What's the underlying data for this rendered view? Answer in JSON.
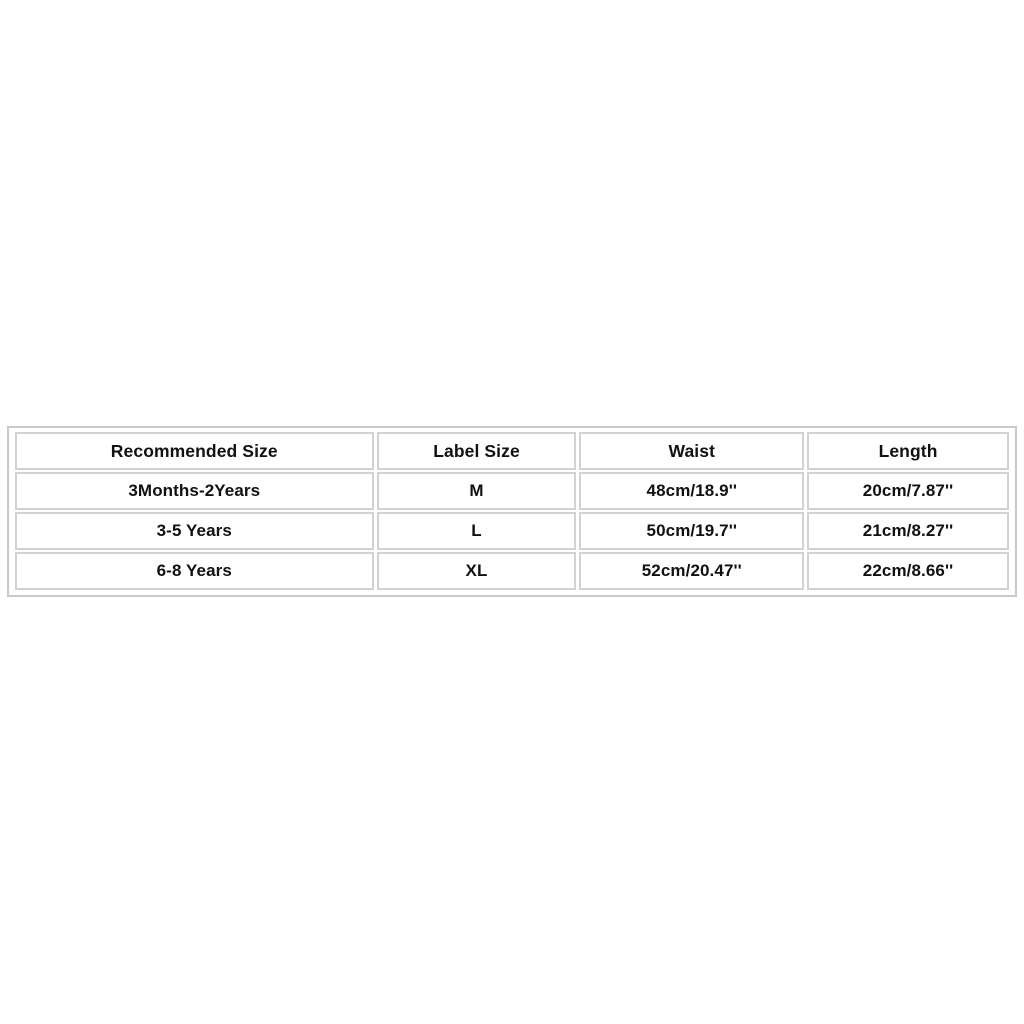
{
  "page": {
    "background_color": "#ffffff",
    "content_type": "size-chart-table"
  },
  "size_chart": {
    "border_color": "#c8c8c8",
    "cell_border_color": "#d2d2d2",
    "text_color": "#111111",
    "columns": [
      {
        "key": "recommended_size",
        "header": "Recommended Size"
      },
      {
        "key": "label_size",
        "header": "Label Size"
      },
      {
        "key": "waist",
        "header": "Waist"
      },
      {
        "key": "length",
        "header": "Length"
      }
    ],
    "rows": [
      {
        "recommended_size": "3Months-2Years",
        "label_size": "M",
        "waist": "48cm/18.9''",
        "length": "20cm/7.87''"
      },
      {
        "recommended_size": "3-5 Years",
        "label_size": "L",
        "waist": "50cm/19.7''",
        "length": "21cm/8.27''"
      },
      {
        "recommended_size": "6-8 Years",
        "label_size": "XL",
        "waist": "52cm/20.47''",
        "length": "22cm/8.66''"
      }
    ]
  }
}
